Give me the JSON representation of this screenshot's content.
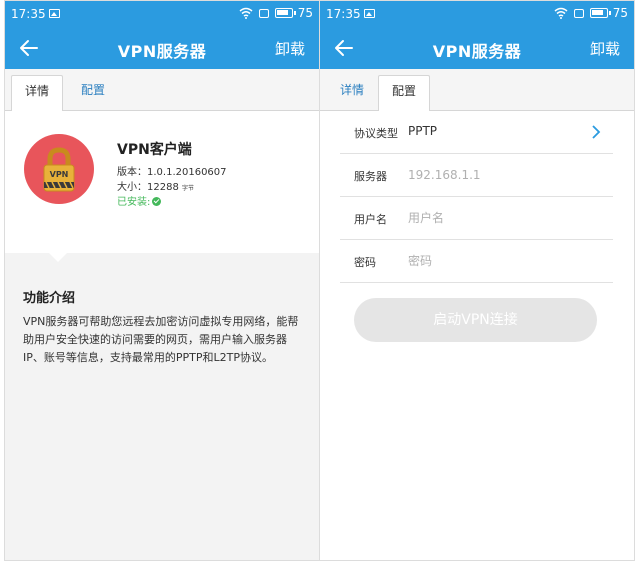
{
  "status_bar": {
    "time": "17:35",
    "battery": "75"
  },
  "app_bar": {
    "title": "VPN服务器",
    "action": "卸载"
  },
  "tabs": [
    "详情",
    "配置"
  ],
  "app": {
    "name": "VPN客户端",
    "version": "版本：1.0.1.20160607",
    "size_label": "大小：",
    "size_value": "12288",
    "size_unit": "字节",
    "installed": "已安装:",
    "icon_text": "VPN"
  },
  "description": {
    "title": "功能介绍",
    "text": "VPN服务器可帮助您远程去加密访问虚拟专用网络，能帮助用户安全快速的访问需要的网页，需用户输入服务器IP、账号等信息，支持最常用的PPTP和L2TP协议。"
  },
  "config": {
    "protocol_label": "协议类型",
    "protocol_value": "PPTP",
    "server_label": "服务器",
    "server_placeholder": "192.168.1.1",
    "username_label": "用户名",
    "username_placeholder": "用户名",
    "password_label": "密码",
    "password_placeholder": "密码",
    "connect_button": "启动VPN连接"
  },
  "colors": {
    "primary": "#2b9be0",
    "icon_circle": "#e8555b",
    "lock_body": "#e8b23a",
    "installed_green": "#43b85a"
  }
}
